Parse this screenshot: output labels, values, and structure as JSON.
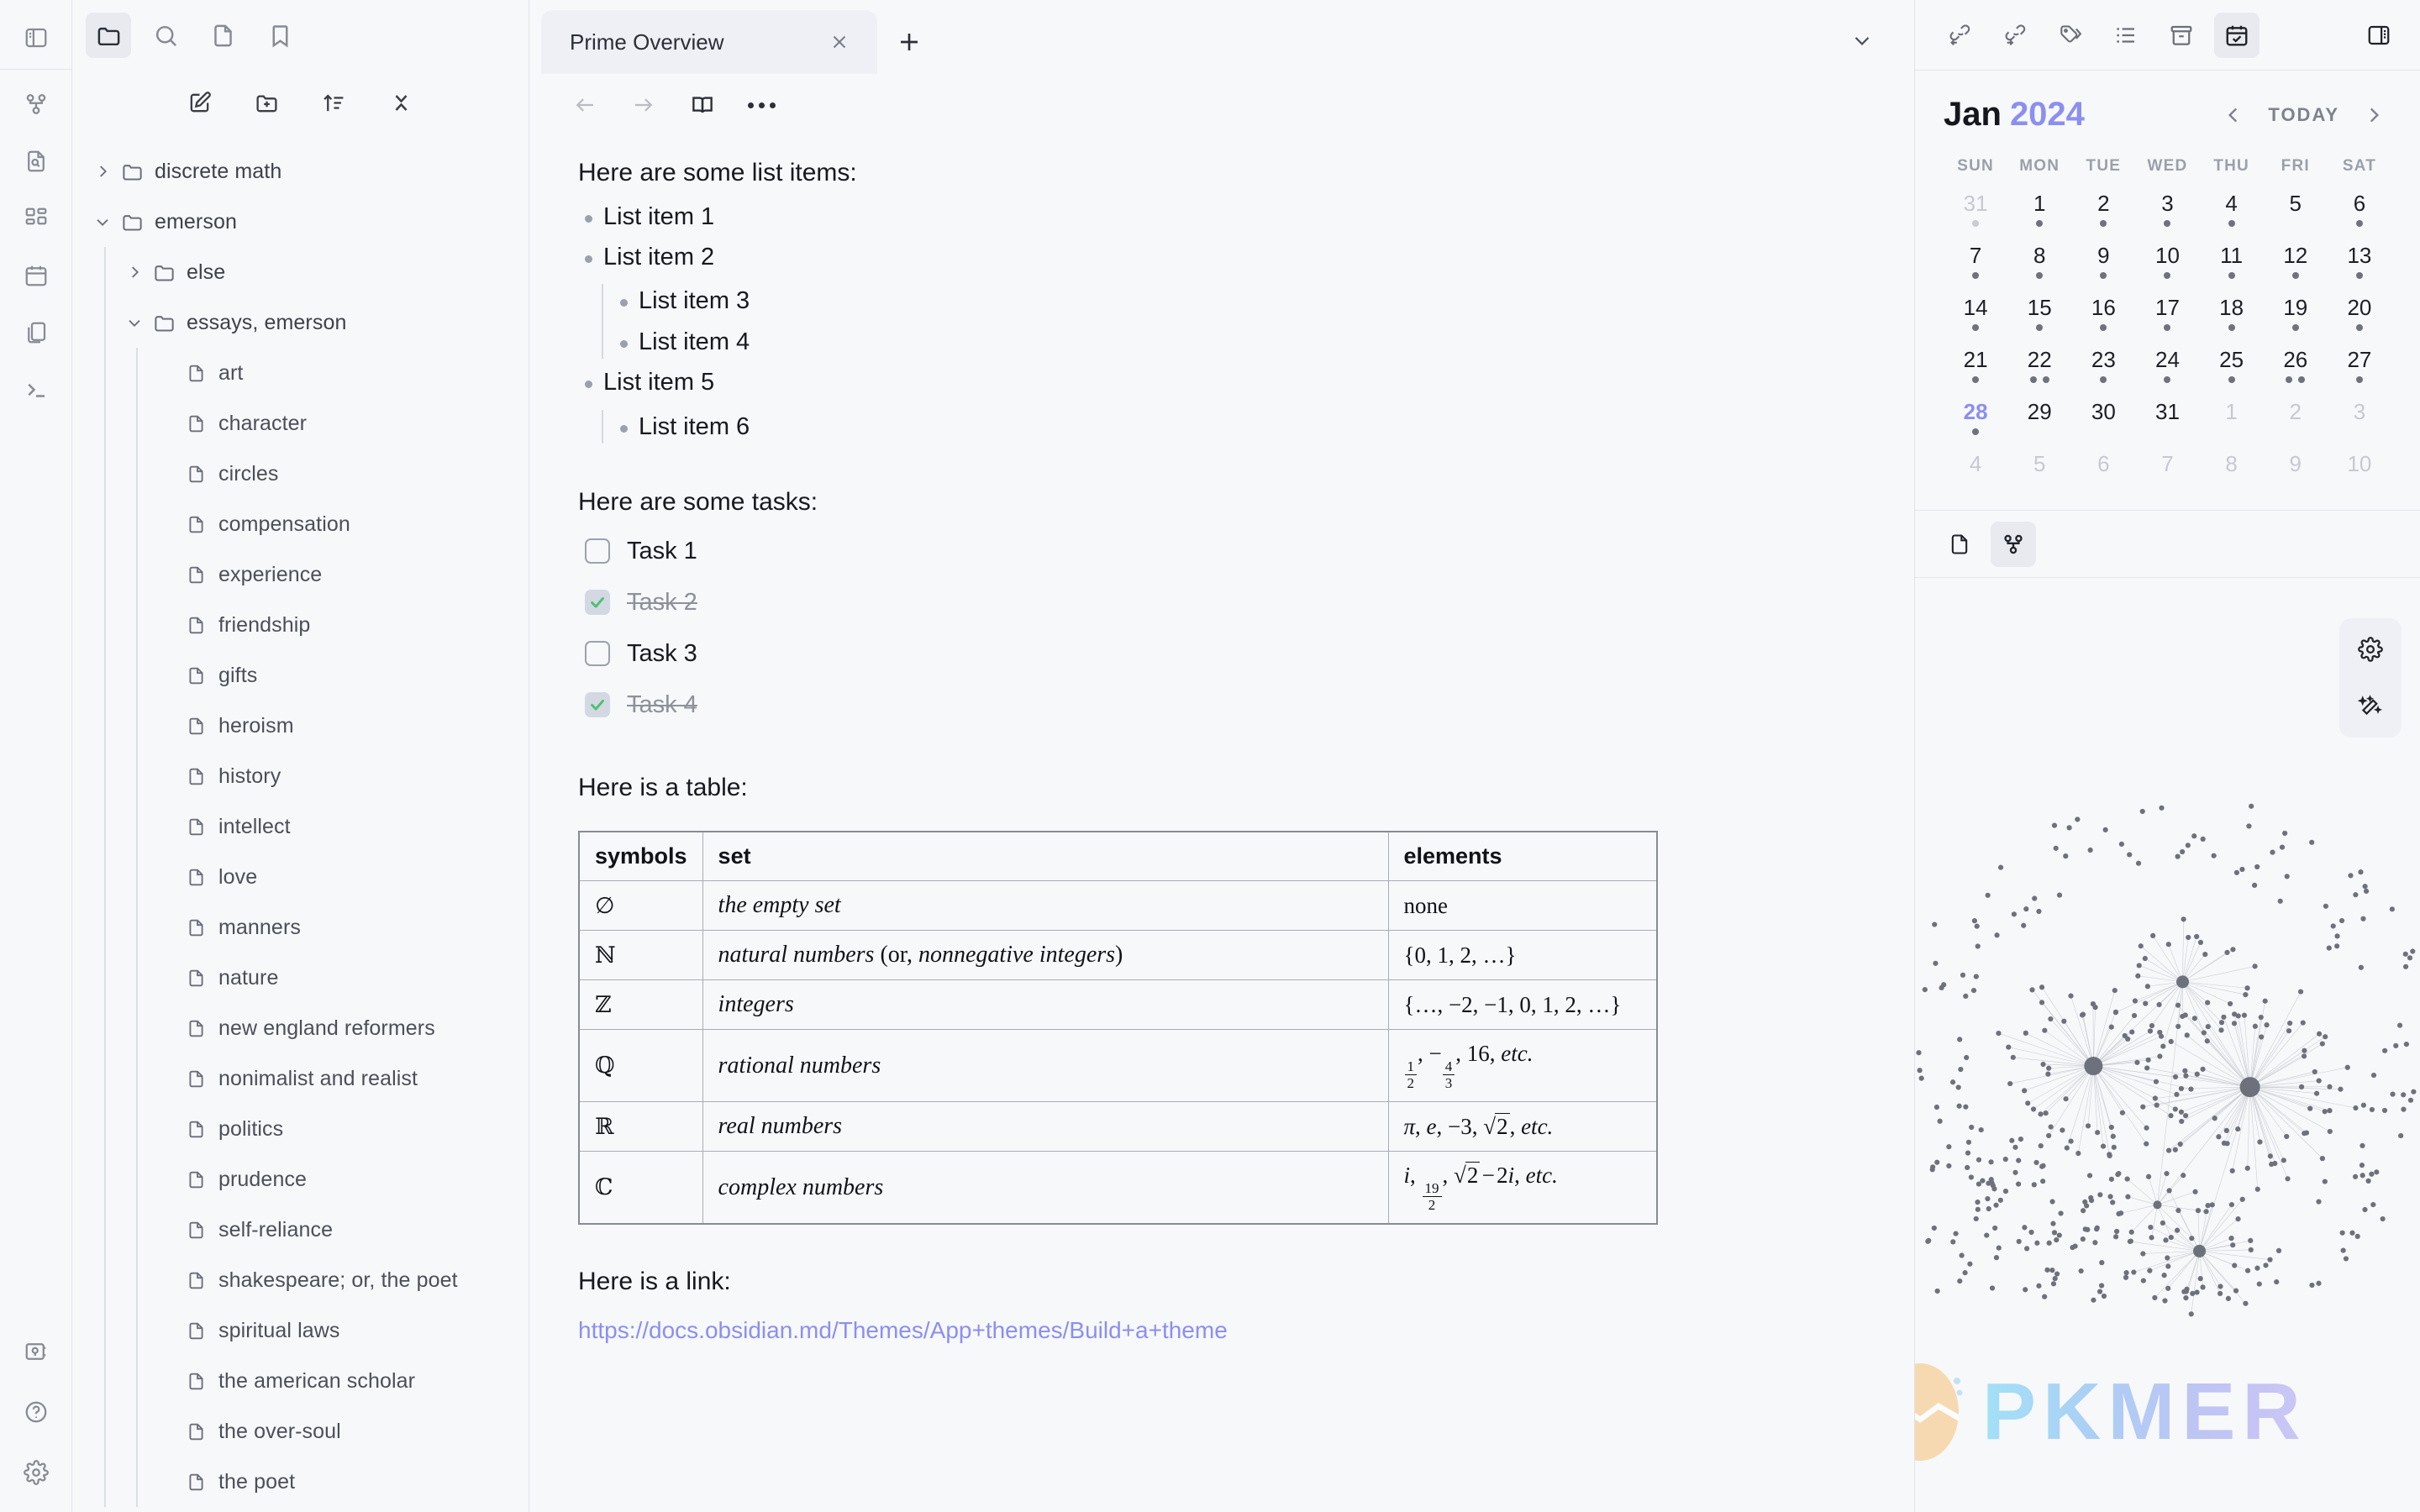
{
  "ribbon": {
    "top_items": [
      {
        "icon": "sidebar-toggle-icon",
        "name": "toggle-left-sidebar"
      }
    ],
    "mid_items": [
      {
        "icon": "graph-icon",
        "name": "ribbon-graph-view"
      },
      {
        "icon": "file-search-icon",
        "name": "ribbon-search-in-file"
      },
      {
        "icon": "layout-grid-icon",
        "name": "ribbon-canvas"
      },
      {
        "icon": "calendar-icon",
        "name": "ribbon-daily-note"
      },
      {
        "icon": "copy-files-icon",
        "name": "ribbon-templates"
      },
      {
        "icon": "terminal-icon",
        "name": "ribbon-terminal"
      }
    ],
    "bottom_items": [
      {
        "icon": "vault-icon",
        "name": "ribbon-open-vault"
      },
      {
        "icon": "help-icon",
        "name": "ribbon-help"
      },
      {
        "icon": "gear-icon",
        "name": "ribbon-settings"
      }
    ]
  },
  "left_panel": {
    "header_icons": [
      {
        "name": "files-icon",
        "label": "Files",
        "active": true
      },
      {
        "name": "search-icon",
        "label": "Search",
        "active": false
      },
      {
        "name": "page-icon",
        "label": "Quick switcher",
        "active": false
      },
      {
        "name": "bookmark-icon",
        "label": "Bookmarks",
        "active": false
      }
    ],
    "toolbar_icons": [
      {
        "name": "new-note-icon",
        "label": "New note"
      },
      {
        "name": "new-folder-icon",
        "label": "New folder"
      },
      {
        "name": "sort-icon",
        "label": "Change sort order"
      },
      {
        "name": "collapse-all-icon",
        "label": "Collapse all"
      }
    ],
    "tree": [
      {
        "label": "discrete math",
        "type": "folder",
        "depth": 0,
        "expanded": false
      },
      {
        "label": "emerson",
        "type": "folder",
        "depth": 0,
        "expanded": true
      },
      {
        "label": "else",
        "type": "folder",
        "depth": 1,
        "expanded": false
      },
      {
        "label": "essays, emerson",
        "type": "folder",
        "depth": 1,
        "expanded": true
      },
      {
        "label": "art",
        "type": "file",
        "depth": 2
      },
      {
        "label": "character",
        "type": "file",
        "depth": 2
      },
      {
        "label": "circles",
        "type": "file",
        "depth": 2
      },
      {
        "label": "compensation",
        "type": "file",
        "depth": 2
      },
      {
        "label": "experience",
        "type": "file",
        "depth": 2
      },
      {
        "label": "friendship",
        "type": "file",
        "depth": 2
      },
      {
        "label": "gifts",
        "type": "file",
        "depth": 2
      },
      {
        "label": "heroism",
        "type": "file",
        "depth": 2
      },
      {
        "label": "history",
        "type": "file",
        "depth": 2
      },
      {
        "label": "intellect",
        "type": "file",
        "depth": 2
      },
      {
        "label": "love",
        "type": "file",
        "depth": 2
      },
      {
        "label": "manners",
        "type": "file",
        "depth": 2
      },
      {
        "label": "nature",
        "type": "file",
        "depth": 2
      },
      {
        "label": "new england reformers",
        "type": "file",
        "depth": 2
      },
      {
        "label": "nonimalist and realist",
        "type": "file",
        "depth": 2
      },
      {
        "label": "politics",
        "type": "file",
        "depth": 2
      },
      {
        "label": "prudence",
        "type": "file",
        "depth": 2
      },
      {
        "label": "self-reliance",
        "type": "file",
        "depth": 2
      },
      {
        "label": "shakespeare; or, the poet",
        "type": "file",
        "depth": 2
      },
      {
        "label": "spiritual laws",
        "type": "file",
        "depth": 2
      },
      {
        "label": "the american scholar",
        "type": "file",
        "depth": 2
      },
      {
        "label": "the over-soul",
        "type": "file",
        "depth": 2
      },
      {
        "label": "the poet",
        "type": "file",
        "depth": 2
      }
    ]
  },
  "tabs": {
    "items": [
      {
        "label": "Prime Overview",
        "active": true
      }
    ],
    "new_tab_label": "+",
    "close_label": "×"
  },
  "editor_toolbar": [
    {
      "name": "back-icon",
      "label": "Navigate back"
    },
    {
      "name": "forward-icon",
      "label": "Navigate forward"
    },
    {
      "name": "reading-view-icon",
      "label": "Reading view"
    },
    {
      "name": "more-options-icon",
      "label": "More options"
    }
  ],
  "document": {
    "list_heading": "Here are some list items:",
    "list_items": [
      {
        "label": "List item 1",
        "level": 1
      },
      {
        "label": "List item 2",
        "level": 1
      },
      {
        "label": "List item 3",
        "level": 2
      },
      {
        "label": "List item 4",
        "level": 2
      },
      {
        "label": "List item 5",
        "level": 1
      },
      {
        "label": "List item 6",
        "level": 2
      }
    ],
    "tasks_heading": "Here are some tasks:",
    "tasks": [
      {
        "label": "Task 1",
        "checked": false
      },
      {
        "label": "Task 2",
        "checked": true
      },
      {
        "label": "Task 3",
        "checked": false
      },
      {
        "label": "Task 4",
        "checked": true
      }
    ],
    "table_heading": "Here is a table:",
    "table": {
      "headers": [
        "symbols",
        "set",
        "elements"
      ],
      "rows": [
        {
          "symbol": "∅",
          "set": "the empty set",
          "elements": "none"
        },
        {
          "symbol": "ℕ",
          "set": "natural numbers (or, nonnegative integers)",
          "elements": "{0, 1, 2, …}"
        },
        {
          "symbol": "ℤ",
          "set": "integers",
          "elements": "{…, −2, −1, 0, 1, 2, …}"
        },
        {
          "symbol": "ℚ",
          "set": "rational numbers",
          "elements": "1/2, −4/3, 16, etc."
        },
        {
          "symbol": "ℝ",
          "set": "real numbers",
          "elements": "π, e, −3, √2, etc."
        },
        {
          "symbol": "ℂ",
          "set": "complex numbers",
          "elements": "i, 19/2, √2 − 2i, etc."
        }
      ]
    },
    "link_heading": "Here is a link:",
    "link_text": "https://docs.obsidian.md/Themes/App+themes/Build+a+theme"
  },
  "right_toolbar": [
    {
      "name": "backlinks-icon",
      "label": "Backlinks",
      "active": false
    },
    {
      "name": "outgoing-links-icon",
      "label": "Outgoing links",
      "active": false
    },
    {
      "name": "tags-icon",
      "label": "Tags",
      "active": false
    },
    {
      "name": "outline-icon",
      "label": "Outline",
      "active": false
    },
    {
      "name": "archive-icon",
      "label": "Archive",
      "active": false
    },
    {
      "name": "calendar-check-icon",
      "label": "Calendar",
      "active": true
    },
    {
      "name": "sidebar-right-toggle-icon",
      "label": "Toggle right sidebar",
      "active": false
    }
  ],
  "calendar": {
    "month": "Jan",
    "year": "2024",
    "today_label": "TODAY",
    "prev_label": "‹",
    "next_label": "›",
    "accent_color": "#8b8ff0",
    "dow": [
      "SUN",
      "MON",
      "TUE",
      "WED",
      "THU",
      "FRI",
      "SAT"
    ],
    "weeks": [
      [
        {
          "n": "31",
          "out": true,
          "dots": 1
        },
        {
          "n": "1",
          "dots": 1
        },
        {
          "n": "2",
          "dots": 1
        },
        {
          "n": "3",
          "dots": 1
        },
        {
          "n": "4",
          "dots": 1
        },
        {
          "n": "5",
          "dots": 0
        },
        {
          "n": "6",
          "dots": 1
        }
      ],
      [
        {
          "n": "7",
          "dots": 1
        },
        {
          "n": "8",
          "dots": 1
        },
        {
          "n": "9",
          "dots": 1
        },
        {
          "n": "10",
          "dots": 1
        },
        {
          "n": "11",
          "dots": 1
        },
        {
          "n": "12",
          "dots": 1
        },
        {
          "n": "13",
          "dots": 1
        }
      ],
      [
        {
          "n": "14",
          "dots": 1
        },
        {
          "n": "15",
          "dots": 1
        },
        {
          "n": "16",
          "dots": 1
        },
        {
          "n": "17",
          "dots": 1
        },
        {
          "n": "18",
          "dots": 1
        },
        {
          "n": "19",
          "dots": 1
        },
        {
          "n": "20",
          "dots": 1
        }
      ],
      [
        {
          "n": "21",
          "dots": 1
        },
        {
          "n": "22",
          "dots": 2
        },
        {
          "n": "23",
          "dots": 1
        },
        {
          "n": "24",
          "dots": 1
        },
        {
          "n": "25",
          "dots": 1
        },
        {
          "n": "26",
          "dots": 2
        },
        {
          "n": "27",
          "dots": 1
        }
      ],
      [
        {
          "n": "28",
          "dots": 1,
          "today": true
        },
        {
          "n": "29",
          "dots": 0
        },
        {
          "n": "30",
          "dots": 0
        },
        {
          "n": "31",
          "dots": 0
        },
        {
          "n": "1",
          "out": true,
          "dots": 0
        },
        {
          "n": "2",
          "out": true,
          "dots": 0
        },
        {
          "n": "3",
          "out": true,
          "dots": 0
        }
      ],
      [
        {
          "n": "4",
          "out": true,
          "dots": 0
        },
        {
          "n": "5",
          "out": true,
          "dots": 0
        },
        {
          "n": "6",
          "out": true,
          "dots": 0
        },
        {
          "n": "7",
          "out": true,
          "dots": 0
        },
        {
          "n": "8",
          "out": true,
          "dots": 0
        },
        {
          "n": "9",
          "out": true,
          "dots": 0
        },
        {
          "n": "10",
          "out": true,
          "dots": 0
        }
      ]
    ]
  },
  "graph_panel": {
    "tabs": [
      {
        "name": "file-view-icon",
        "label": "File view",
        "active": false
      },
      {
        "name": "graph-view-icon",
        "label": "Graph view",
        "active": true
      }
    ],
    "controls": [
      {
        "name": "gear-icon",
        "label": "Graph settings"
      },
      {
        "name": "magic-wand-icon",
        "label": "Restore default view"
      }
    ]
  },
  "watermark": {
    "text": "PKMER"
  }
}
